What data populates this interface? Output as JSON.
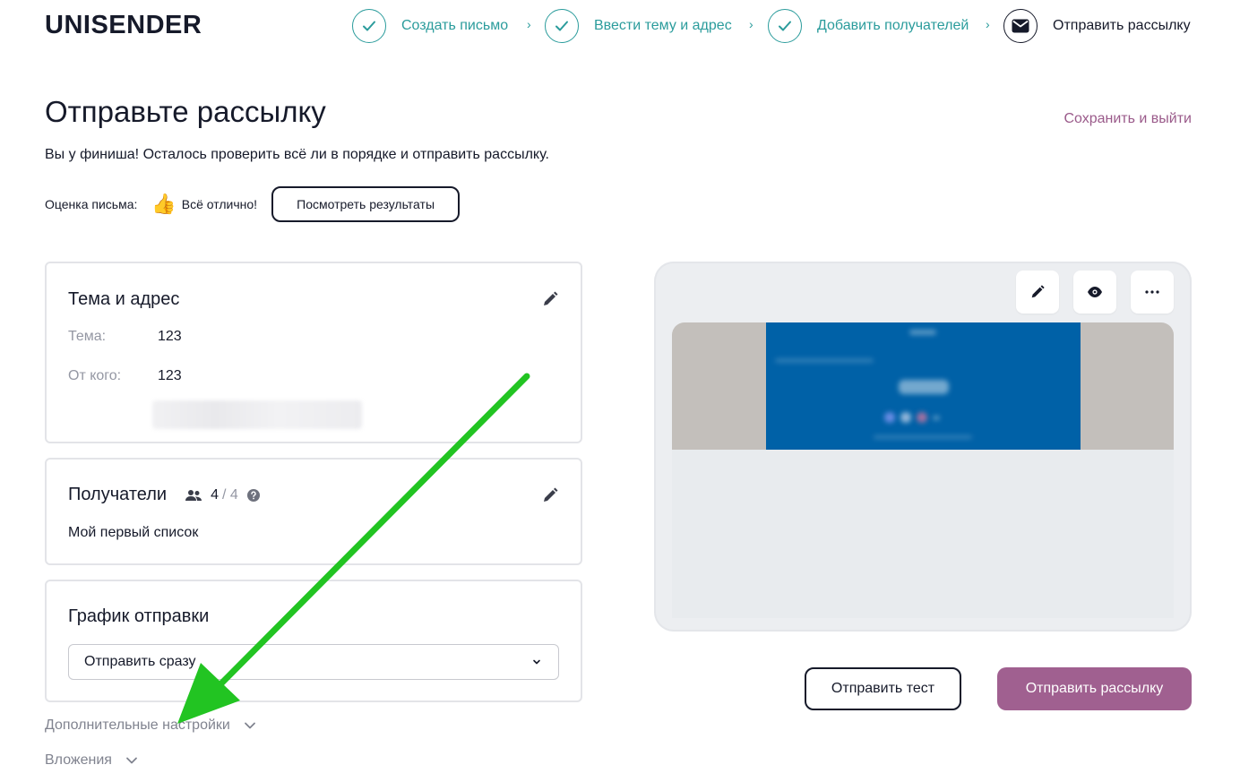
{
  "header": {
    "logo": "UNISENDER",
    "steps": [
      {
        "label": "Создать письмо",
        "state": "done"
      },
      {
        "label": "Ввести тему и адрес",
        "state": "done"
      },
      {
        "label": "Добавить получателей",
        "state": "done"
      },
      {
        "label": "Отправить рассылку",
        "state": "active"
      }
    ],
    "separator": "›"
  },
  "page": {
    "title": "Отправьте рассылку",
    "save_exit": "Сохранить и выйти",
    "subtitle": "Вы у финиша! Осталось проверить всё ли в порядке и отправить рассылку."
  },
  "score": {
    "label": "Оценка письма:",
    "emoji": "👍",
    "value": "Всё отлично!",
    "button": "Посмотреть результаты"
  },
  "subject_card": {
    "title": "Тема и адрес",
    "subject_label": "Тема:",
    "subject_value": "123",
    "from_label": "От кого:",
    "from_value": "123"
  },
  "recipients_card": {
    "title": "Получатели",
    "count": "4",
    "total": "/ 4",
    "list_name": "Мой первый список"
  },
  "schedule_card": {
    "title": "График отправки",
    "selected": "Отправить сразу"
  },
  "extra": {
    "settings": "Дополнительные настройки",
    "attachments": "Вложения"
  },
  "actions": {
    "send_test": "Отправить тест",
    "send_campaign": "Отправить рассылку"
  },
  "colors": {
    "accent_teal": "#2b9c9c",
    "brand_purple": "#a06090",
    "link_purple": "#9a5a8a",
    "annotation_green": "#22c422",
    "preview_blue": "#0061a7"
  },
  "icons": {
    "step_done": "check-icon",
    "step_active": "envelope-icon",
    "edit": "pencil-icon",
    "preview": "eye-icon",
    "more": "more-dots-icon",
    "recipients": "people-icon",
    "help": "help-icon",
    "expand": "chevron-down-icon",
    "annotation": "green-arrow"
  }
}
